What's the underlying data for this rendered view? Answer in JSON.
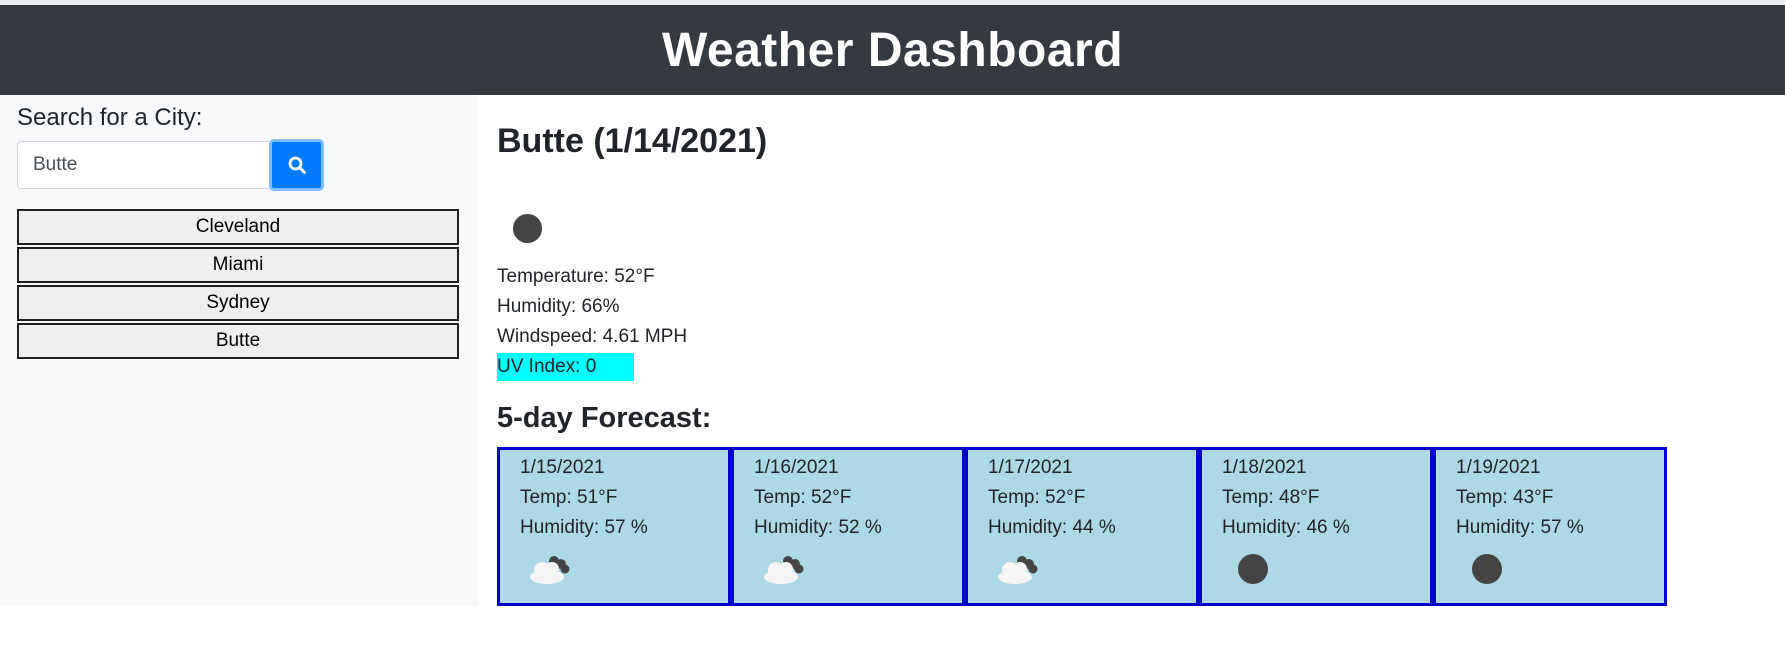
{
  "header": {
    "title": "Weather Dashboard"
  },
  "sidebar": {
    "search_label": "Search for a City:",
    "search_value": "Butte",
    "search_button_icon": "search-icon",
    "history": [
      "Cleveland",
      "Miami",
      "Sydney",
      "Butte"
    ]
  },
  "current": {
    "title": "Butte (1/14/2021)",
    "icon": "moon-icon",
    "temperature": "Temperature: 52°F",
    "humidity": "Humidity: 66%",
    "windspeed": "Windspeed: 4.61 MPH",
    "uv_index": "UV Index: 0",
    "uv_color": "#00ffff"
  },
  "forecast": {
    "title": "5-day Forecast:",
    "days": [
      {
        "date": "1/15/2021",
        "temp": "Temp: 51°F",
        "humidity": "Humidity: 57 %",
        "icon": "cloud-moon-icon"
      },
      {
        "date": "1/16/2021",
        "temp": "Temp: 52°F",
        "humidity": "Humidity: 52 %",
        "icon": "cloud-moon-icon"
      },
      {
        "date": "1/17/2021",
        "temp": "Temp: 52°F",
        "humidity": "Humidity: 44 %",
        "icon": "cloud-moon-icon"
      },
      {
        "date": "1/18/2021",
        "temp": "Temp: 48°F",
        "humidity": "Humidity: 46 %",
        "icon": "moon-icon"
      },
      {
        "date": "1/19/2021",
        "temp": "Temp: 43°F",
        "humidity": "Humidity: 57 %",
        "icon": "moon-icon"
      }
    ]
  },
  "colors": {
    "header_bg": "#343a40",
    "accent": "#007bff",
    "card_bg": "#add8e6",
    "card_border": "#0000cd"
  }
}
